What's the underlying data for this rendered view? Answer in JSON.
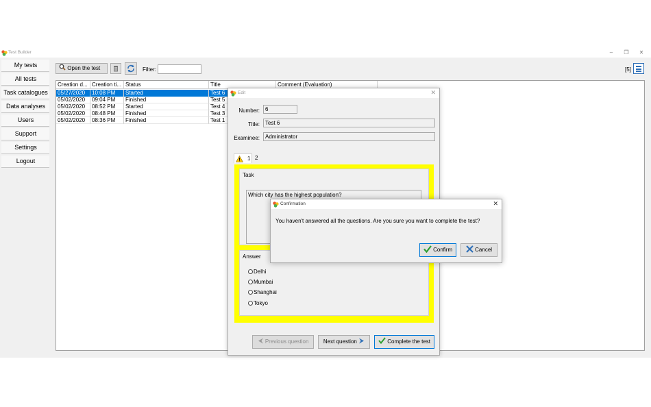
{
  "window": {
    "title": "Test Builder",
    "controls": {
      "minimize": "–",
      "restore": "❐",
      "close": "✕"
    }
  },
  "sidebar": {
    "items": [
      {
        "label": "My tests"
      },
      {
        "label": "All tests"
      },
      {
        "label": "Task catalogues"
      },
      {
        "label": "Data analyses"
      },
      {
        "label": "Users"
      },
      {
        "label": "Support"
      },
      {
        "label": "Settings"
      },
      {
        "label": "Logout"
      }
    ]
  },
  "toolbar": {
    "open_label": "Open the test",
    "filter_label": "Filter:",
    "filter_value": "",
    "count": "[5]"
  },
  "table": {
    "columns": [
      "Creation d...",
      "Creation ti...",
      "Status",
      "Title",
      "Comment (Evaluation)"
    ],
    "rows": [
      {
        "date": "05/27/2020",
        "time": "10:08 PM",
        "status": "Started",
        "title": "Test 6",
        "selected": true
      },
      {
        "date": "05/02/2020",
        "time": "09:04 PM",
        "status": "Finished",
        "title": "Test 5"
      },
      {
        "date": "05/02/2020",
        "time": "08:52 PM",
        "status": "Started",
        "title": "Test 4"
      },
      {
        "date": "05/02/2020",
        "time": "08:48 PM",
        "status": "Finished",
        "title": "Test 3"
      },
      {
        "date": "05/02/2020",
        "time": "08:36 PM",
        "status": "Finished",
        "title": "Test 1"
      }
    ]
  },
  "edit_dialog": {
    "title": "Edit",
    "close": "✕",
    "number_label": "Number:",
    "number_value": "6",
    "title_label": "Title:",
    "title_value": "Test 6",
    "examinee_label": "Examinee:",
    "examinee_value": "Administrator",
    "tabs": [
      {
        "label": "1",
        "warning": true
      },
      {
        "label": "2"
      }
    ],
    "task_label": "Task",
    "task_text": "Which city has the highest population?",
    "answer_label": "Answer",
    "options": [
      "Delhi",
      "Mumbai",
      "Shanghai",
      "Tokyo"
    ],
    "prev_label": "Previous question",
    "next_label": "Next question",
    "complete_label": "Complete the test",
    "highlight_color": "#ffff00"
  },
  "confirm_dialog": {
    "title": "Confirmation",
    "close": "✕",
    "message": "You haven't answered all the questions. Are you sure you want to complete the test?",
    "confirm_label": "Confirm",
    "cancel_label": "Cancel"
  }
}
